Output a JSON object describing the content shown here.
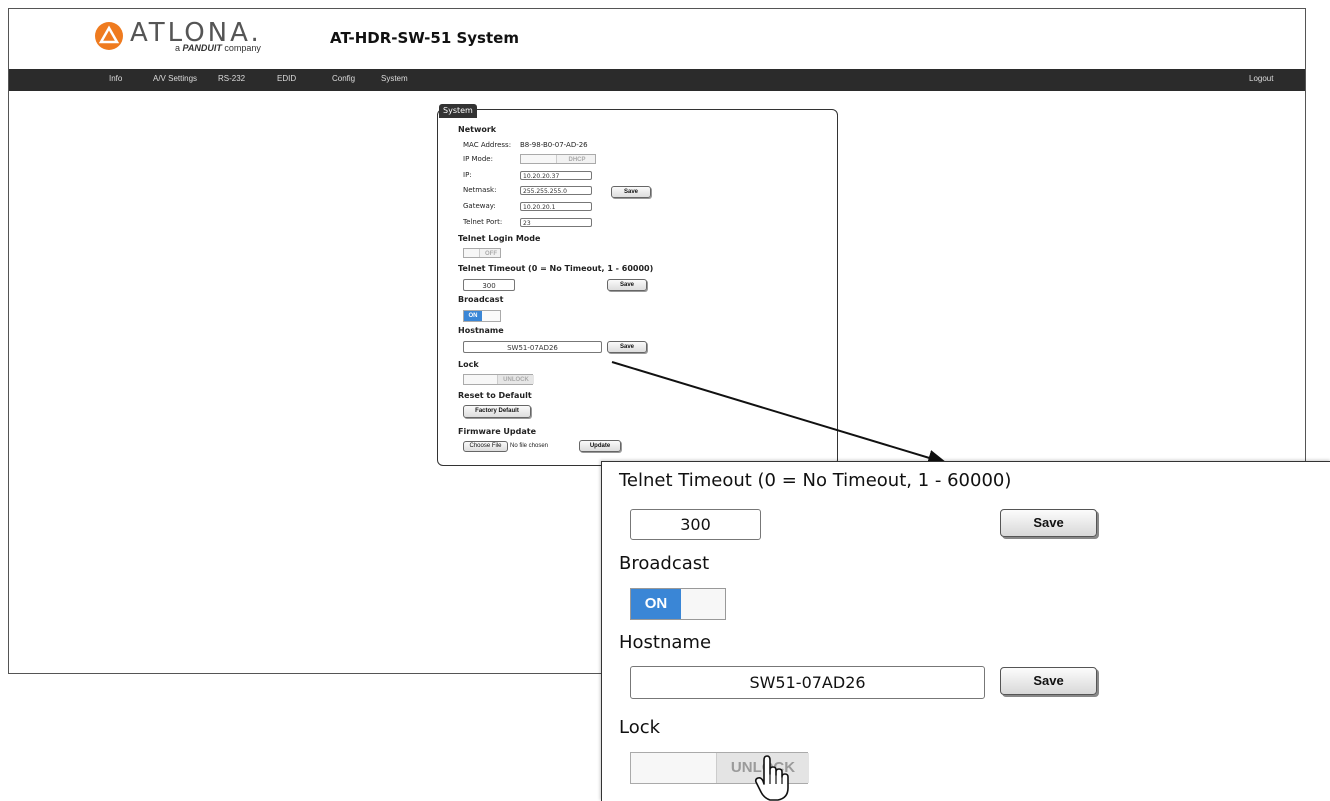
{
  "header": {
    "logo_text": "ATLONA.",
    "logo_tagline_prefix": "a",
    "logo_tagline_brand": "PANDUIT",
    "logo_tagline_suffix": "company",
    "page_title": "AT-HDR-SW-51  System"
  },
  "nav": {
    "items": [
      "Info",
      "A/V Settings",
      "RS-232",
      "EDID",
      "Config",
      "System"
    ],
    "logout": "Logout"
  },
  "panel": {
    "tab_label": "System",
    "network": {
      "heading": "Network",
      "mac_label": "MAC Address:",
      "mac_value": "B8-98-B0-07-AD-26",
      "ipmode_label": "IP Mode:",
      "ipmode_value": "DHCP",
      "ip_label": "IP:",
      "ip_value": "10.20.20.37",
      "netmask_label": "Netmask:",
      "netmask_value": "255.255.255.0",
      "gateway_label": "Gateway:",
      "gateway_value": "10.20.20.1",
      "telnet_port_label": "Telnet Port:",
      "telnet_port_value": "23",
      "save_label": "Save"
    },
    "telnet_login": {
      "heading": "Telnet Login Mode",
      "state": "OFF"
    },
    "telnet_timeout": {
      "heading": "Telnet Timeout (0 = No Timeout, 1 - 60000)",
      "value": "300",
      "save_label": "Save"
    },
    "broadcast": {
      "heading": "Broadcast",
      "state": "ON"
    },
    "hostname": {
      "heading": "Hostname",
      "value": "SW51-07AD26",
      "save_label": "Save"
    },
    "lock": {
      "heading": "Lock",
      "state": "UNLOCK"
    },
    "reset": {
      "heading": "Reset to Default",
      "button_label": "Factory Default"
    },
    "firmware": {
      "heading": "Firmware Update",
      "choose_label": "Choose File",
      "no_file": "No file chosen",
      "update_label": "Update"
    }
  },
  "colors": {
    "accent_on": "#3a86d6",
    "logo_orange": "#ef7b1f",
    "navbar": "#2b2b2b"
  }
}
